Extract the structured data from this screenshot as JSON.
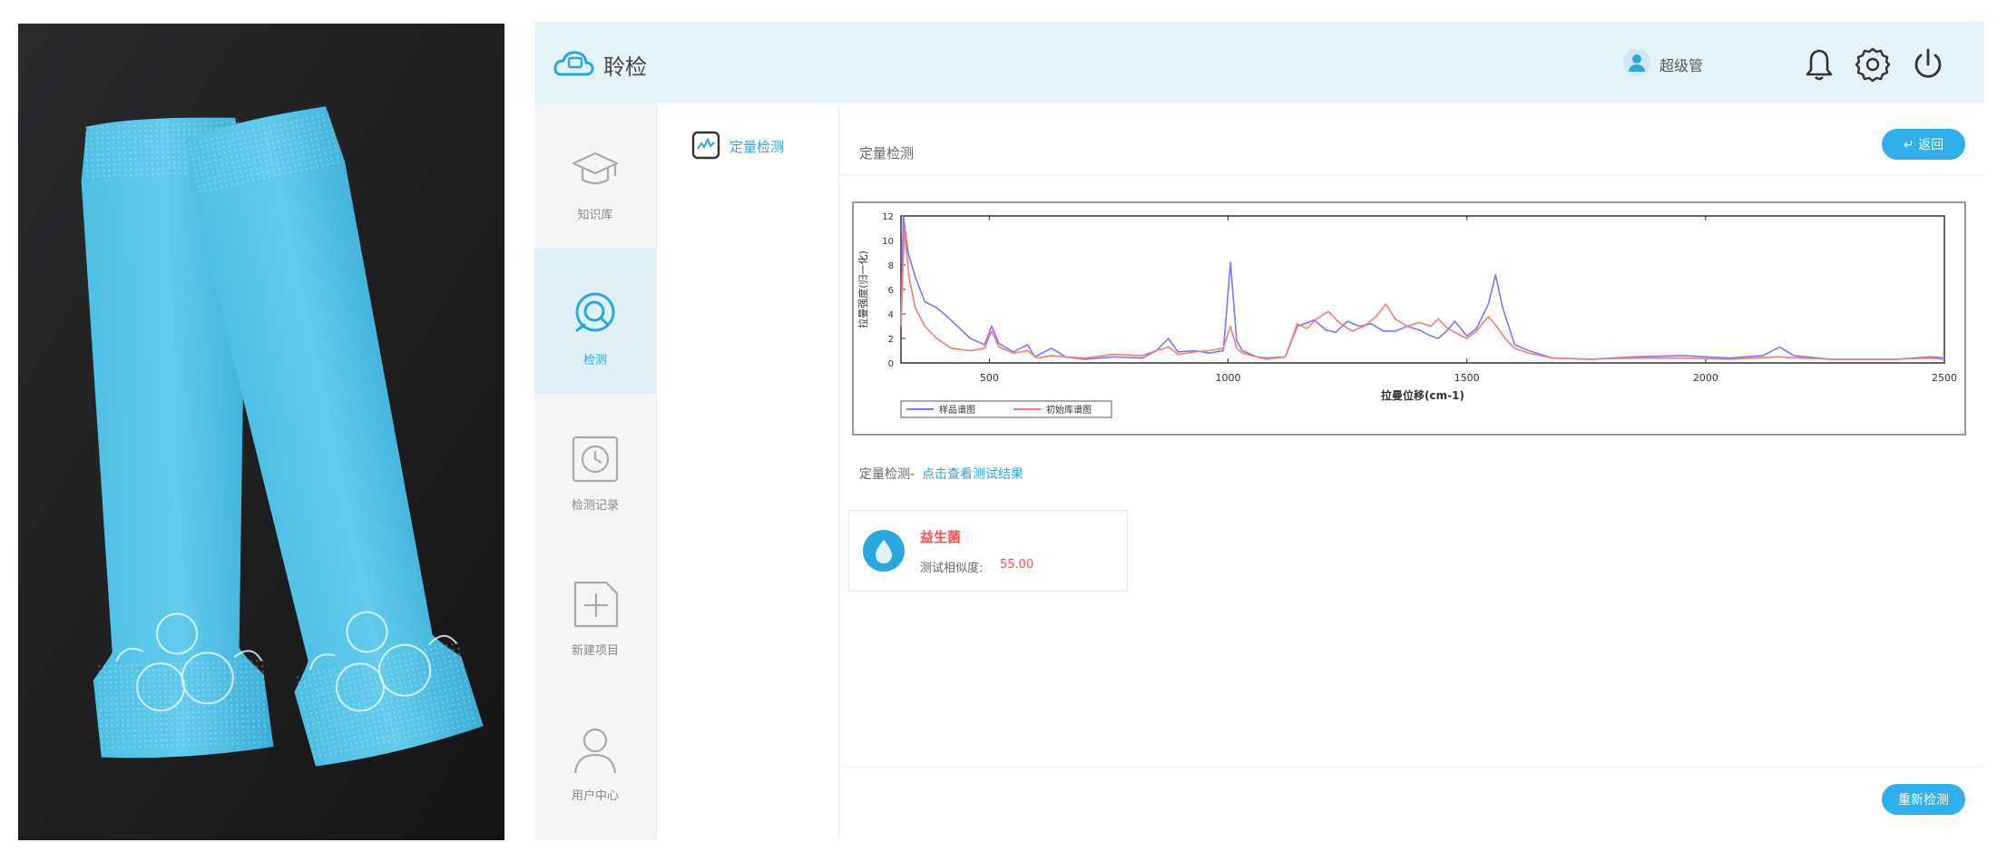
{
  "app": {
    "name": "聆检",
    "user_name": "超级管"
  },
  "nav": {
    "items": [
      {
        "label": "知识库",
        "icon": "graduation-cap-icon",
        "active": false
      },
      {
        "label": "检测",
        "icon": "detect-icon",
        "active": true
      },
      {
        "label": "检测记录",
        "icon": "history-clock-icon",
        "active": false
      },
      {
        "label": "新建项目",
        "icon": "add-square-icon",
        "active": false
      },
      {
        "label": "用户中心",
        "icon": "user-icon",
        "active": false
      }
    ]
  },
  "subnav": {
    "label": "定量检测"
  },
  "main": {
    "section_title": "定量检测",
    "back_label": "返回",
    "result_title": "定量检测-",
    "result_link": "点击查看测试结果",
    "result_card": {
      "name": "益生菌",
      "score_label": "测试相似度:",
      "score_value": "55.00"
    },
    "retest_label": "重新检测"
  },
  "colors": {
    "accent": "#2db0ec",
    "nav_active_bg": "#dff0f7",
    "alert_red": "#ff4d4d",
    "series_sample": "#7777ff",
    "series_reference": "#ff7777"
  },
  "chart_data": {
    "type": "line",
    "xlabel": "拉曼位移(cm-1)",
    "ylabel": "拉曼强度(归一化)",
    "xlim": [
      315,
      2500
    ],
    "ylim": [
      0,
      1.2
    ],
    "xticks": [
      500,
      1000,
      1500,
      2000,
      2500
    ],
    "yticks": [
      0,
      0.2,
      0.4,
      0.6,
      0.8,
      1.0,
      1.2
    ],
    "ytick_labels": [
      "0",
      "2",
      "4",
      "6",
      "8",
      "10",
      "12"
    ],
    "legend_position": "bottom-left",
    "series": [
      {
        "name": "样品谱图",
        "color": "#7777ff",
        "points": [
          [
            315,
            0.3
          ],
          [
            320,
            1.2
          ],
          [
            330,
            0.9
          ],
          [
            345,
            0.7
          ],
          [
            365,
            0.5
          ],
          [
            390,
            0.45
          ],
          [
            420,
            0.35
          ],
          [
            460,
            0.2
          ],
          [
            490,
            0.15
          ],
          [
            505,
            0.3
          ],
          [
            520,
            0.16
          ],
          [
            550,
            0.09
          ],
          [
            580,
            0.15
          ],
          [
            595,
            0.05
          ],
          [
            630,
            0.12
          ],
          [
            660,
            0.05
          ],
          [
            700,
            0.03
          ],
          [
            760,
            0.05
          ],
          [
            820,
            0.04
          ],
          [
            850,
            0.1
          ],
          [
            875,
            0.2
          ],
          [
            895,
            0.09
          ],
          [
            930,
            0.1
          ],
          [
            960,
            0.08
          ],
          [
            990,
            0.1
          ],
          [
            1005,
            0.82
          ],
          [
            1018,
            0.18
          ],
          [
            1030,
            0.1
          ],
          [
            1060,
            0.05
          ],
          [
            1080,
            0.04
          ],
          [
            1120,
            0.05
          ],
          [
            1145,
            0.3
          ],
          [
            1160,
            0.32
          ],
          [
            1180,
            0.35
          ],
          [
            1205,
            0.27
          ],
          [
            1225,
            0.25
          ],
          [
            1250,
            0.34
          ],
          [
            1275,
            0.3
          ],
          [
            1300,
            0.32
          ],
          [
            1325,
            0.26
          ],
          [
            1350,
            0.26
          ],
          [
            1375,
            0.3
          ],
          [
            1400,
            0.27
          ],
          [
            1425,
            0.22
          ],
          [
            1440,
            0.2
          ],
          [
            1455,
            0.25
          ],
          [
            1475,
            0.34
          ],
          [
            1500,
            0.22
          ],
          [
            1520,
            0.28
          ],
          [
            1545,
            0.48
          ],
          [
            1560,
            0.72
          ],
          [
            1575,
            0.45
          ],
          [
            1600,
            0.15
          ],
          [
            1630,
            0.1
          ],
          [
            1680,
            0.04
          ],
          [
            1760,
            0.03
          ],
          [
            1850,
            0.05
          ],
          [
            1950,
            0.06
          ],
          [
            2050,
            0.04
          ],
          [
            2120,
            0.06
          ],
          [
            2155,
            0.13
          ],
          [
            2185,
            0.06
          ],
          [
            2260,
            0.03
          ],
          [
            2400,
            0.03
          ],
          [
            2470,
            0.05
          ],
          [
            2500,
            0.04
          ]
        ]
      },
      {
        "name": "初始库谱图",
        "color": "#ff7777",
        "points": [
          [
            315,
            0.3
          ],
          [
            322,
            1.1
          ],
          [
            332,
            0.7
          ],
          [
            345,
            0.45
          ],
          [
            365,
            0.3
          ],
          [
            390,
            0.2
          ],
          [
            420,
            0.12
          ],
          [
            460,
            0.1
          ],
          [
            490,
            0.12
          ],
          [
            505,
            0.26
          ],
          [
            520,
            0.13
          ],
          [
            550,
            0.08
          ],
          [
            580,
            0.1
          ],
          [
            600,
            0.04
          ],
          [
            630,
            0.06
          ],
          [
            660,
            0.05
          ],
          [
            700,
            0.04
          ],
          [
            760,
            0.07
          ],
          [
            820,
            0.06
          ],
          [
            850,
            0.1
          ],
          [
            875,
            0.13
          ],
          [
            895,
            0.07
          ],
          [
            930,
            0.09
          ],
          [
            960,
            0.1
          ],
          [
            990,
            0.12
          ],
          [
            1005,
            0.3
          ],
          [
            1018,
            0.12
          ],
          [
            1030,
            0.08
          ],
          [
            1060,
            0.05
          ],
          [
            1080,
            0.03
          ],
          [
            1120,
            0.05
          ],
          [
            1145,
            0.32
          ],
          [
            1165,
            0.28
          ],
          [
            1185,
            0.36
          ],
          [
            1210,
            0.42
          ],
          [
            1235,
            0.32
          ],
          [
            1260,
            0.26
          ],
          [
            1285,
            0.3
          ],
          [
            1310,
            0.38
          ],
          [
            1330,
            0.48
          ],
          [
            1350,
            0.36
          ],
          [
            1375,
            0.3
          ],
          [
            1400,
            0.33
          ],
          [
            1425,
            0.3
          ],
          [
            1440,
            0.36
          ],
          [
            1460,
            0.28
          ],
          [
            1480,
            0.24
          ],
          [
            1500,
            0.2
          ],
          [
            1520,
            0.26
          ],
          [
            1545,
            0.38
          ],
          [
            1562,
            0.3
          ],
          [
            1580,
            0.2
          ],
          [
            1600,
            0.12
          ],
          [
            1630,
            0.08
          ],
          [
            1680,
            0.04
          ],
          [
            1760,
            0.03
          ],
          [
            1850,
            0.04
          ],
          [
            1950,
            0.04
          ],
          [
            2050,
            0.03
          ],
          [
            2150,
            0.05
          ],
          [
            2260,
            0.03
          ],
          [
            2400,
            0.03
          ],
          [
            2470,
            0.04
          ],
          [
            2500,
            0.03
          ]
        ]
      }
    ]
  }
}
